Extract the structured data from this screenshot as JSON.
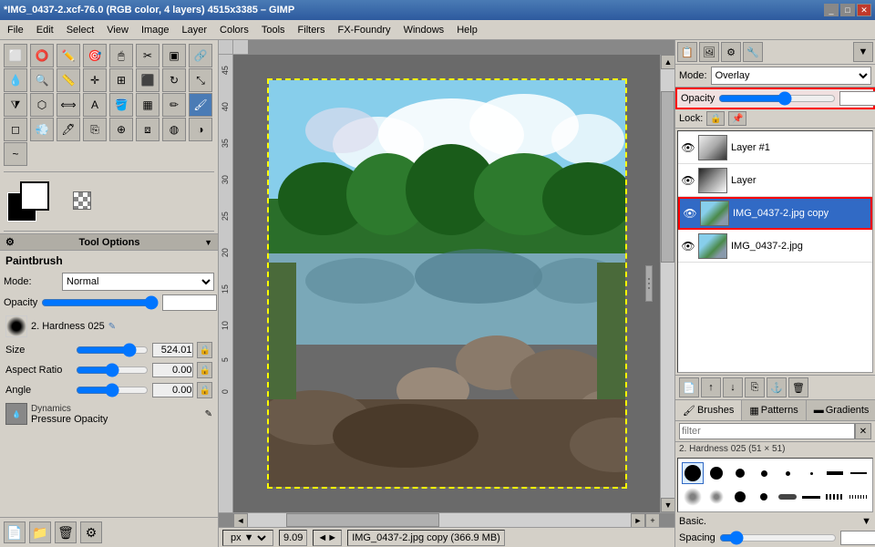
{
  "window": {
    "title": "*IMG_0437-2.xcf-76.0 (RGB color, 4 layers) 4515x3385 – GIMP",
    "controls": [
      "_",
      "□",
      "✕"
    ]
  },
  "menu": {
    "items": [
      "File",
      "Edit",
      "Select",
      "View",
      "Image",
      "Layer",
      "Colors",
      "Tools",
      "Filters",
      "FX-Foundry",
      "Windows",
      "Help"
    ]
  },
  "toolbox": {
    "label": "Paintbrush",
    "mode_label": "Mode:",
    "mode_value": "Normal",
    "opacity_label": "Opacity",
    "opacity_value": "100.0",
    "brush_label": "Brush",
    "brush_name": "2. Hardness 025",
    "size_label": "Size",
    "size_value": "524.01",
    "aspect_label": "Aspect Ratio",
    "aspect_value": "0.00",
    "angle_label": "Angle",
    "angle_value": "0.00",
    "dynamics_label": "Dynamics",
    "dynamics_name": "Pressure Opacity"
  },
  "canvas": {
    "zoom": "9.09",
    "unit": "px",
    "filename": "IMG_0437-2.jpg copy (366.9 MB)"
  },
  "layers": {
    "mode_label": "Mode:",
    "mode_value": "Overlay",
    "opacity_label": "Opacity",
    "opacity_value": "57.2",
    "lock_label": "Lock:",
    "items": [
      {
        "name": "Layer #1",
        "visible": true,
        "thumb": "bw",
        "active": false,
        "highlighted": false
      },
      {
        "name": "Layer",
        "visible": true,
        "thumb": "bw",
        "active": false,
        "highlighted": false
      },
      {
        "name": "IMG_0437-2.jpg copy",
        "visible": true,
        "thumb": "photo",
        "active": true,
        "highlighted": true
      },
      {
        "name": "IMG_0437-2.jpg",
        "visible": true,
        "thumb": "photo",
        "active": false,
        "highlighted": false
      }
    ]
  },
  "brushes": {
    "tabs": [
      "Brushes",
      "Patterns",
      "Gradients"
    ],
    "filter_placeholder": "filter",
    "active_tab": "Brushes",
    "brush_info": "2. Hardness 025 (51 × 51)",
    "section_label": "Basic.",
    "spacing_label": "Spacing",
    "spacing_value": "10.0"
  }
}
